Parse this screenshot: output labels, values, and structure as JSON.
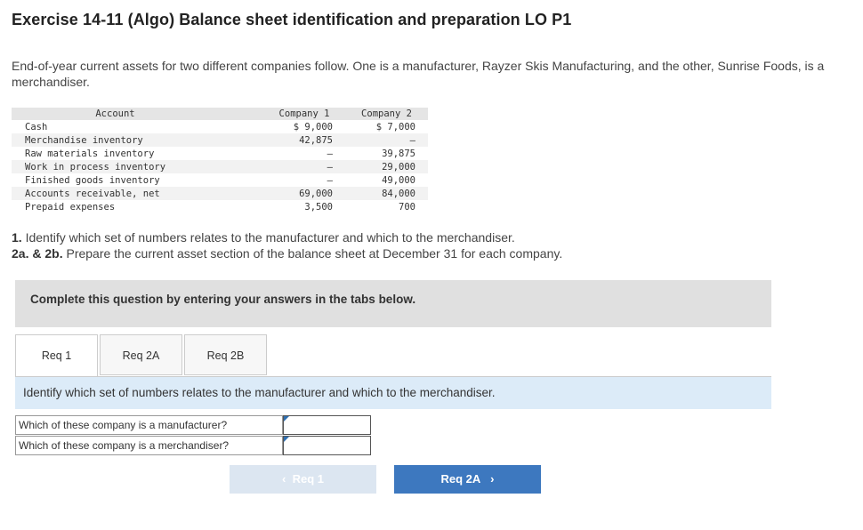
{
  "title": "Exercise 14-11 (Algo) Balance sheet identification and preparation LO P1",
  "intro": "End-of-year current assets for two different companies follow. One is a manufacturer, Rayzer Skis Manufacturing, and the other, Sunrise Foods, is a merchandiser.",
  "table": {
    "headers": {
      "account": "Account",
      "company1": "Company 1",
      "company2": "Company 2"
    },
    "rows": [
      {
        "account": "Cash",
        "c1": "$ 9,000",
        "c2": "$ 7,000"
      },
      {
        "account": "Merchandise inventory",
        "c1": "42,875",
        "c2": "–"
      },
      {
        "account": "Raw materials inventory",
        "c1": "–",
        "c2": "39,875"
      },
      {
        "account": "Work in process inventory",
        "c1": "–",
        "c2": "29,000"
      },
      {
        "account": "Finished goods inventory",
        "c1": "–",
        "c2": "49,000"
      },
      {
        "account": "Accounts receivable, net",
        "c1": "69,000",
        "c2": "84,000"
      },
      {
        "account": "Prepaid expenses",
        "c1": "3,500",
        "c2": "700"
      }
    ]
  },
  "questions": {
    "q1_num": "1.",
    "q1_text": " Identify which set of numbers relates to the manufacturer and which to the merchandiser.",
    "q2_num": "2a. & 2b.",
    "q2_text": " Prepare the current asset section of the balance sheet at December 31 for each company."
  },
  "banner": "Complete this question by entering your answers in the tabs below.",
  "tabs": [
    "Req 1",
    "Req 2A",
    "Req 2B"
  ],
  "instruction": "Identify which set of numbers relates to the manufacturer and which to the merchandiser.",
  "answers": [
    {
      "label": "Which of these company is a manufacturer?",
      "value": ""
    },
    {
      "label": "Which of these company is a merchandiser?",
      "value": ""
    }
  ],
  "nav": {
    "prev_label": "Req 1",
    "next_label": "Req 2A",
    "prev_icon": "chevron-left-icon",
    "next_icon": "chevron-right-icon"
  },
  "colors": {
    "banner_bg": "#e0e0e0",
    "instruction_bg": "#dcebf8",
    "next_button": "#3d78bf",
    "prev_button": "#dce6f1"
  }
}
